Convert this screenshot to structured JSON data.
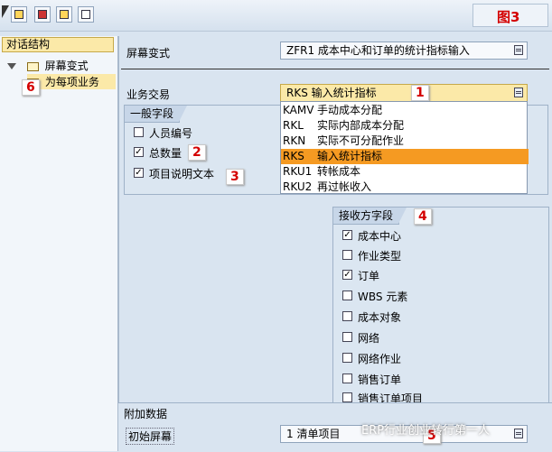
{
  "figure_label": "图3",
  "left_panel": {
    "title": "对话结构",
    "tree": [
      {
        "label": "屏幕变式",
        "expanded": true
      },
      {
        "label": "为每项业务"
      }
    ],
    "marker": "6"
  },
  "screen_variant": {
    "label": "屏幕变式",
    "value": "ZFR1 成本中心和订单的统计指标输入"
  },
  "business_transaction": {
    "label": "业务交易",
    "value": "RKS 输入统计指标",
    "marker": "1",
    "options": [
      {
        "code": "KAMV",
        "text": "手动成本分配",
        "selected": false
      },
      {
        "code": "RKL",
        "text": "实际内部成本分配",
        "selected": false
      },
      {
        "code": "RKN",
        "text": "实际不可分配作业",
        "selected": false
      },
      {
        "code": "RKS",
        "text": "输入统计指标",
        "selected": true
      },
      {
        "code": "RKU1",
        "text": "转帐成本",
        "selected": false
      },
      {
        "code": "RKU2",
        "text": "再过帐收入",
        "selected": false
      }
    ]
  },
  "general_fields": {
    "title": "一般字段",
    "items": [
      {
        "label": "人员编号",
        "checked": false
      },
      {
        "label": "总数量",
        "checked": true
      },
      {
        "label": "项目说明文本",
        "checked": true
      }
    ],
    "markers": [
      "2",
      "3"
    ]
  },
  "receiver_fields": {
    "title": "接收方字段",
    "marker": "4",
    "items": [
      {
        "label": "成本中心",
        "checked": true
      },
      {
        "label": "作业类型",
        "checked": false
      },
      {
        "label": "订单",
        "checked": true
      },
      {
        "label": "WBS 元素",
        "checked": false
      },
      {
        "label": "成本对象",
        "checked": false
      },
      {
        "label": "网络",
        "checked": false
      },
      {
        "label": "网络作业",
        "checked": false
      },
      {
        "label": "销售订单",
        "checked": false
      },
      {
        "label": "销售订单项目",
        "checked": false
      }
    ]
  },
  "additional_data": {
    "title": "附加数据",
    "initial_screen_label": "初始屏幕",
    "initial_screen_value": "1 清单项目",
    "marker": "5"
  },
  "watermark": "ERP行业创业转行第一人"
}
